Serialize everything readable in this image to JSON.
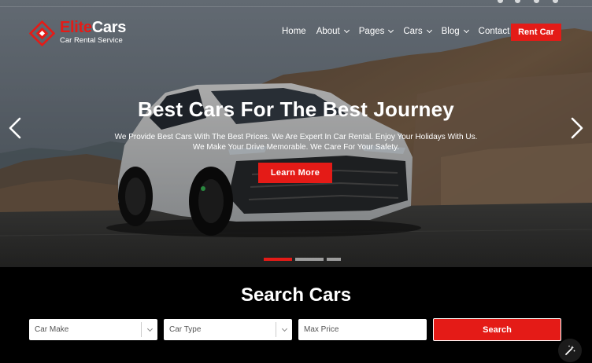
{
  "brand": {
    "name_red": "Elite",
    "name_white": "Cars",
    "tagline": "Car Rental Service"
  },
  "nav": {
    "items": [
      {
        "label": "Home",
        "dropdown": false
      },
      {
        "label": "About",
        "dropdown": true
      },
      {
        "label": "Pages",
        "dropdown": true
      },
      {
        "label": "Cars",
        "dropdown": true
      },
      {
        "label": "Blog",
        "dropdown": true
      },
      {
        "label": "Contact",
        "dropdown": false
      }
    ],
    "cta_label": "Rent Car"
  },
  "hero": {
    "title": "Best Cars For The Best Journey",
    "subtitle_line1": "We Provide Best Cars With The Best Prices. We Are Expert In Car Rental. Enjoy Your Holidays With Us.",
    "subtitle_line2": "We Make Your Drive Memorable. We Care For Your Safety.",
    "button_label": "Learn More",
    "active_slide": 1,
    "slide_count": 3
  },
  "search": {
    "title": "Search Cars",
    "make_placeholder": "Car Make",
    "type_placeholder": "Car Type",
    "price_placeholder": "Max Price",
    "button_label": "Search"
  },
  "colors": {
    "accent": "#e41b17",
    "background": "#000000",
    "text": "#ffffff"
  },
  "icons": {
    "logo": "diamond-logo-icon",
    "prev": "chevron-left-icon",
    "next": "chevron-right-icon",
    "caret": "chevron-down-icon",
    "magic": "magic-wand-icon"
  }
}
